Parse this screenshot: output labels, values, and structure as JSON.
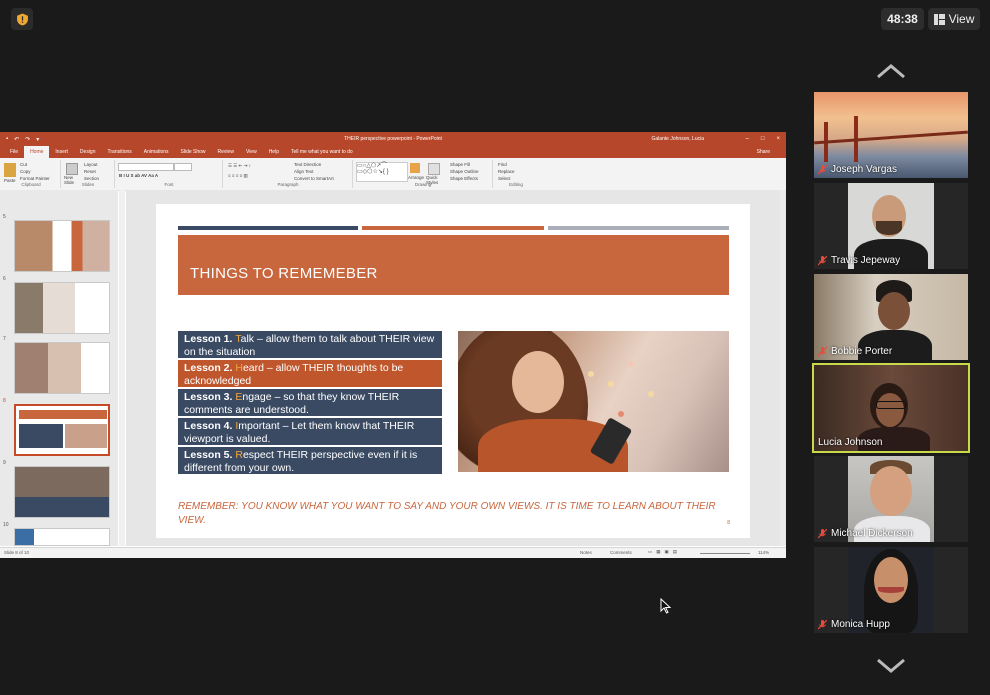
{
  "meeting": {
    "timer": "48:38",
    "view_label": "View"
  },
  "app": {
    "window_title": "THEIR perspective powerpoint - PowerPoint",
    "user": "Galante Johnson, Lucia",
    "tabs": [
      "File",
      "Home",
      "Insert",
      "Design",
      "Transitions",
      "Animations",
      "Slide Show",
      "Review",
      "View",
      "Help",
      "Tell me what you want to do"
    ],
    "active_tab": "Home",
    "share_label": "Share",
    "ribbon": {
      "clipboard": {
        "paste": "Paste",
        "cut": "Cut",
        "copy": "Copy",
        "format_painter": "Format Painter",
        "label": "Clipboard"
      },
      "slides": {
        "new_slide": "New Slide",
        "layout": "Layout",
        "reset": "Reset",
        "section": "Section",
        "label": "Slides"
      },
      "font": {
        "label": "Font"
      },
      "paragraph": {
        "text_direction": "Text Direction",
        "align_text": "Align Text",
        "convert": "Convert to SmartArt",
        "label": "Paragraph"
      },
      "drawing": {
        "arrange": "Arrange",
        "quick_styles": "Quick Styles",
        "shape_fill": "Shape Fill",
        "shape_outline": "Shape Outline",
        "shape_effects": "Shape Effects",
        "label": "Drawing"
      },
      "editing": {
        "find": "Find",
        "replace": "Replace",
        "select": "Select",
        "label": "Editing"
      }
    },
    "thumb_numbers": [
      "5",
      "6",
      "7",
      "8",
      "9",
      "10"
    ],
    "status": {
      "slide_of": "Slide 8 of 10",
      "notes": "Notes",
      "comments": "Comments",
      "zoom": "114%"
    }
  },
  "slide": {
    "title": "THINGS TO REMEMEBER",
    "lessons": [
      {
        "num": "Lesson 1. ",
        "letter": "T",
        "rest": "alk – allow them to talk about THEIR view on the situation",
        "style": "blue"
      },
      {
        "num": "Lesson 2. ",
        "letter": "H",
        "rest": "eard – allow THEIR thoughts to be acknowledged",
        "style": "orange"
      },
      {
        "num": "Lesson 3. ",
        "letter": "E",
        "rest": "ngage – so that they know THEIR comments are understood.",
        "style": "blue"
      },
      {
        "num": "Lesson 4. ",
        "letter": "I",
        "rest": "mportant – Let them know that THEIR viewport is valued.",
        "style": "blue"
      },
      {
        "num": "Lesson 5. ",
        "letter": "R",
        "rest": "espect THEIR perspective even if it is different from your own.",
        "style": "blue"
      }
    ],
    "remember": "REMEMBER: YOU KNOW WHAT YOU WANT TO SAY AND YOUR OWN VIEWS.  IT IS TIME TO LEARN ABOUT THEIR VIEW.",
    "page_number": "8",
    "accent_color": "#c8663d",
    "lesson_blue": "#3a4a63"
  },
  "participants": [
    {
      "name": "Joseph Vargas",
      "muted": true
    },
    {
      "name": "Travis Jepeway",
      "muted": true
    },
    {
      "name": "Bobbie Porter",
      "muted": true
    },
    {
      "name": "Lucia Johnson",
      "muted": false,
      "active_speaker": true
    },
    {
      "name": "Michael Dickerson",
      "muted": true
    },
    {
      "name": "Monica Hupp",
      "muted": true
    }
  ]
}
